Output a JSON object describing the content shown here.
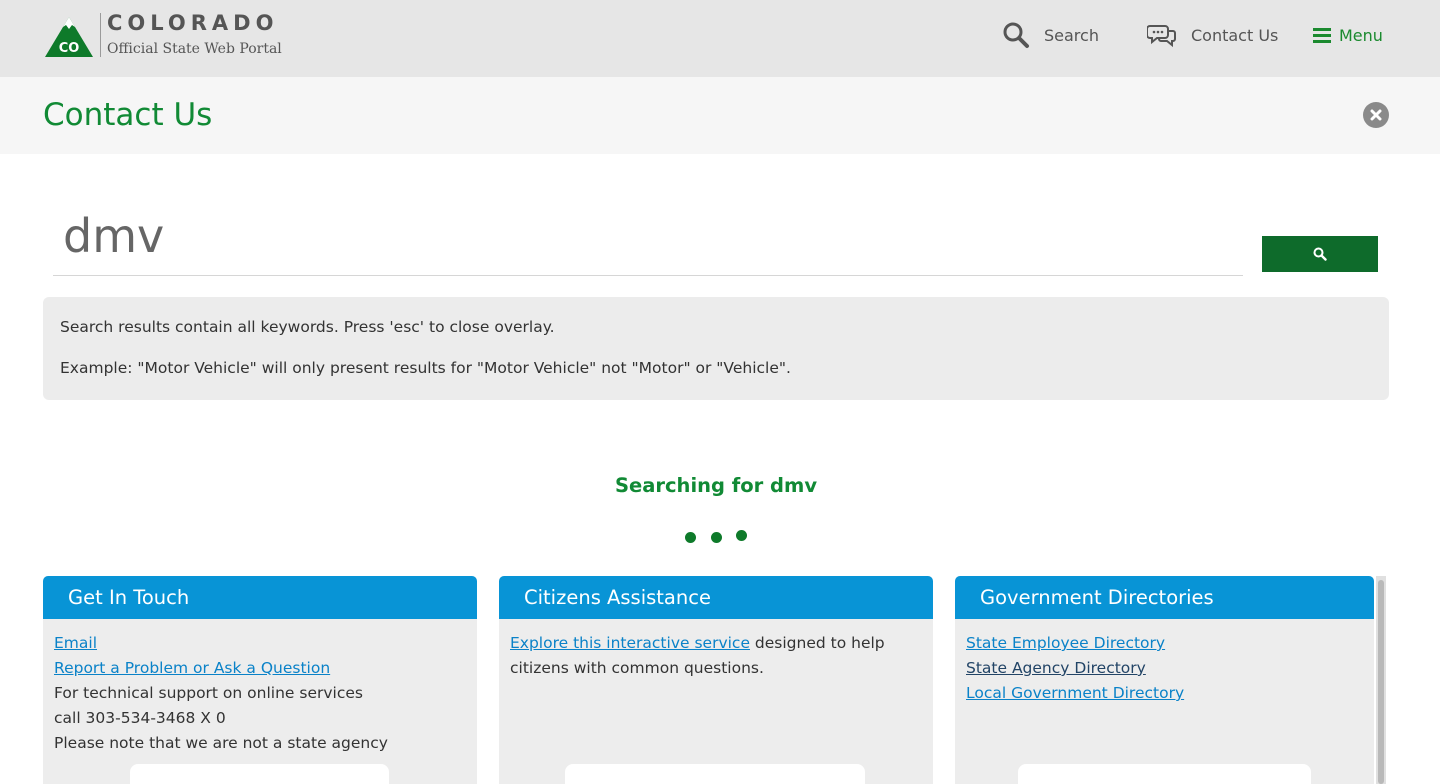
{
  "header": {
    "logo_word": "COLORADO",
    "logo_sub": "Official State Web Portal",
    "logo_mark": "CO",
    "nav": {
      "search": "Search",
      "contact": "Contact Us",
      "menu": "Menu"
    }
  },
  "overlay": {
    "title": "Contact Us"
  },
  "search": {
    "value": "dmv"
  },
  "info": {
    "line1": "Search results contain all keywords. Press 'esc' to close overlay.",
    "line2": "Example: \"Motor Vehicle\" will only present results for \"Motor Vehicle\" not \"Motor\" or \"Vehicle\"."
  },
  "status": {
    "searching": "Searching for dmv"
  },
  "cards": [
    {
      "title": "Get In Touch",
      "links": [
        "Email",
        "Report a Problem or Ask a Question"
      ],
      "text": [
        "For technical support on online services",
        "call 303-534-3468 X 0",
        "Please note that we are not a state agency"
      ]
    },
    {
      "title": "Citizens Assistance",
      "link": "Explore this interactive service",
      "text": " designed to help citizens with common questions."
    },
    {
      "title": "Government Directories",
      "links": [
        "State Employee Directory",
        "State Agency Directory",
        "Local Government Directory"
      ]
    }
  ],
  "colors": {
    "green": "#118a35",
    "blue": "#0894d6",
    "button_green": "#0e6b2b"
  },
  "icons": [
    "search-icon",
    "chat-icon",
    "hamburger-icon",
    "close-icon",
    "magnifier-icon"
  ]
}
